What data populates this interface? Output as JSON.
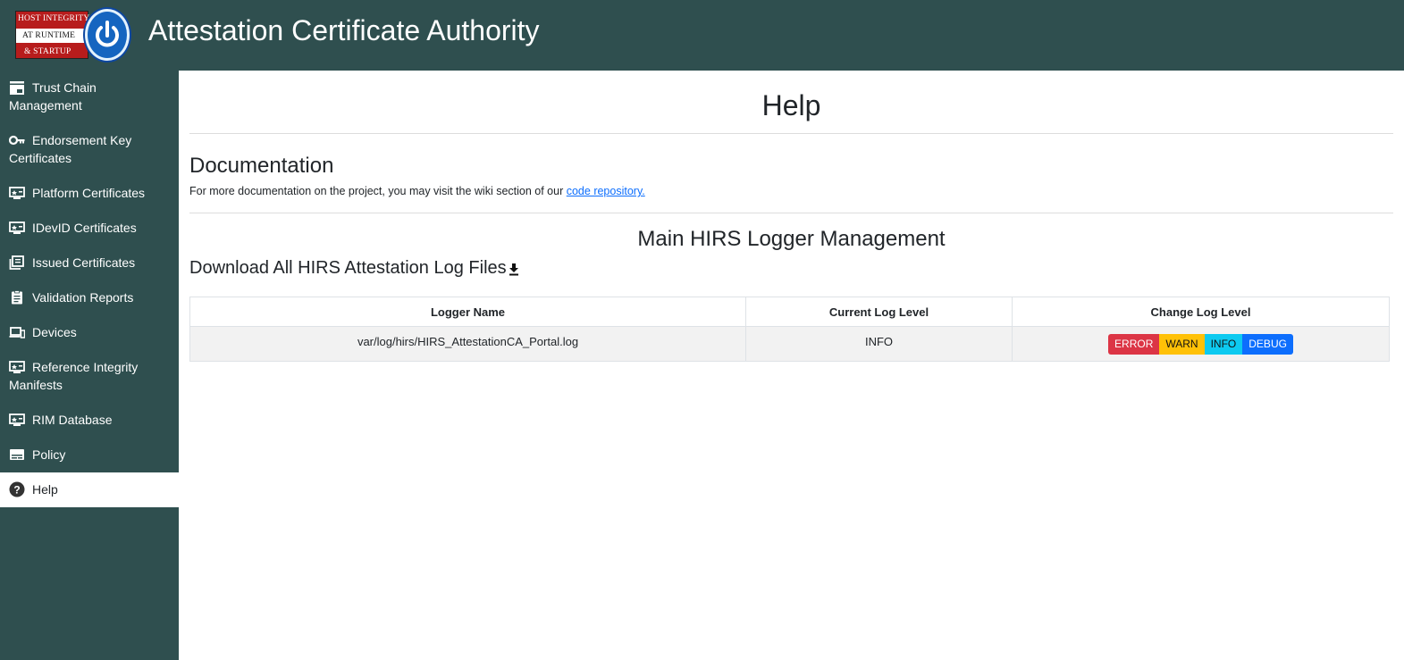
{
  "header": {
    "logo_lines": [
      "HOST INTEGRITY",
      "AT RUNTIME",
      "& STARTUP"
    ],
    "app_title": "Attestation Certificate Authority"
  },
  "sidebar": {
    "items": [
      {
        "label": "Trust Chain Management",
        "icon": "store-icon"
      },
      {
        "label": "Endorsement Key Certificates",
        "icon": "key-icon"
      },
      {
        "label": "Platform Certificates",
        "icon": "certificate-screen-icon"
      },
      {
        "label": "IDevID Certificates",
        "icon": "certificate-screen-icon"
      },
      {
        "label": "Issued Certificates",
        "icon": "library-books-icon"
      },
      {
        "label": "Validation Reports",
        "icon": "clipboard-icon"
      },
      {
        "label": "Devices",
        "icon": "devices-icon"
      },
      {
        "label": "Reference Integrity Manifests",
        "icon": "certificate-screen-icon"
      },
      {
        "label": "RIM Database",
        "icon": "certificate-screen-icon"
      },
      {
        "label": "Policy",
        "icon": "policy-icon"
      },
      {
        "label": "Help",
        "icon": "help-icon",
        "active": true
      }
    ]
  },
  "main": {
    "title": "Help",
    "documentation": {
      "heading": "Documentation",
      "text": "For more documentation on the project, you may visit the wiki section of our ",
      "link_text": "code repository."
    },
    "logger": {
      "title": "Main HIRS Logger Management",
      "download_label": "Download All HIRS Attestation Log Files",
      "columns": [
        "Logger Name",
        "Current Log Level",
        "Change Log Level"
      ],
      "rows": [
        {
          "name": "var/log/hirs/HIRS_AttestationCA_Portal.log",
          "level": "INFO"
        }
      ],
      "level_buttons": [
        "ERROR",
        "WARN",
        "INFO",
        "DEBUG"
      ]
    }
  },
  "colors": {
    "sidebar_bg": "#2f4f4f",
    "error": "#dc3545",
    "warn": "#ffc107",
    "info": "#0dcaf0",
    "debug": "#0d6efd",
    "link": "#0d6efd"
  }
}
